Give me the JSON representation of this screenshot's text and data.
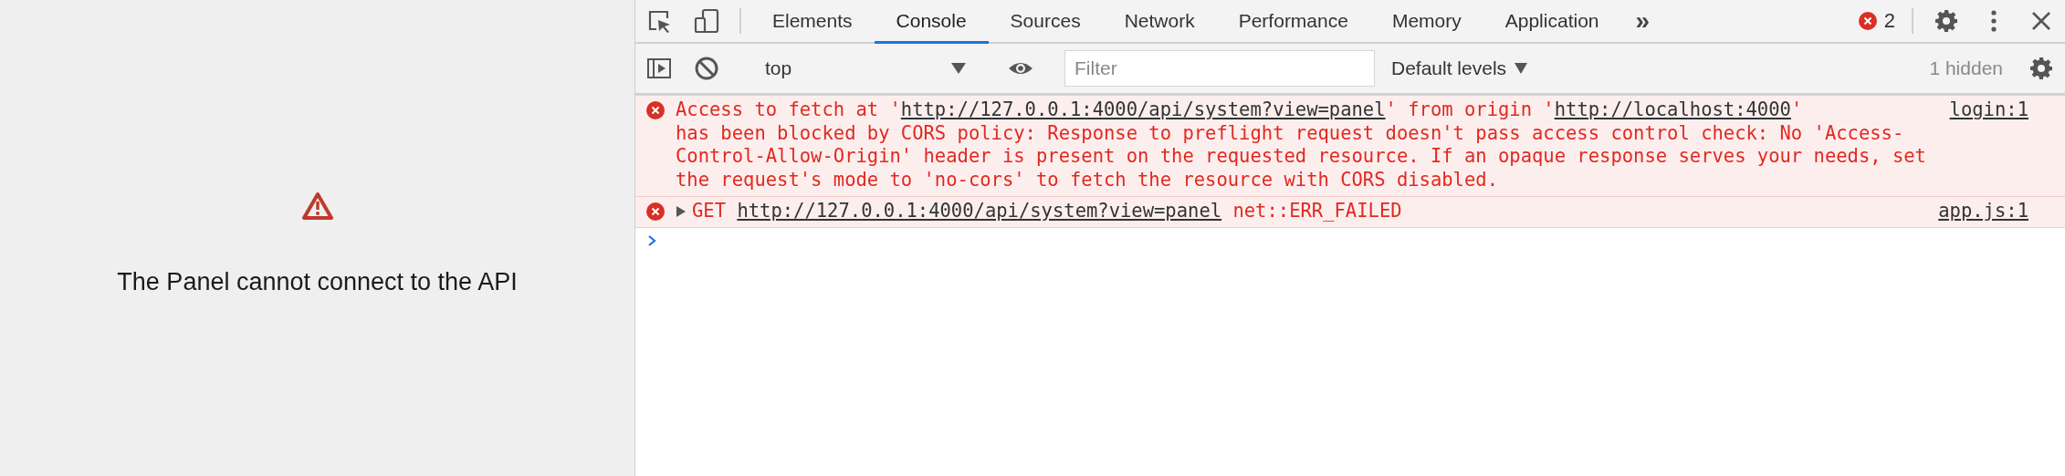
{
  "panel": {
    "message": "The Panel cannot connect to the API"
  },
  "devtools": {
    "tabs": [
      {
        "label": "Elements",
        "selected": false
      },
      {
        "label": "Console",
        "selected": true
      },
      {
        "label": "Sources",
        "selected": false
      },
      {
        "label": "Network",
        "selected": false
      },
      {
        "label": "Performance",
        "selected": false
      },
      {
        "label": "Memory",
        "selected": false
      },
      {
        "label": "Application",
        "selected": false
      }
    ],
    "more_tabs": "»",
    "error_count": "2",
    "toolbar": {
      "context": "top",
      "filter": {
        "placeholder": "Filter"
      },
      "levels": "Default levels",
      "hidden": "1 hidden"
    },
    "messages": [
      {
        "kind": "error",
        "expandable": false,
        "source": "login:1",
        "lines": [
          [
            {
              "kind": "text",
              "text": "Access to fetch at '"
            },
            {
              "kind": "link",
              "text": "http://127.0.0.1:4000/api/system?view=panel"
            },
            {
              "kind": "text",
              "text": "' from origin '"
            },
            {
              "kind": "link",
              "text": "http://localhost:4000"
            },
            {
              "kind": "text",
              "text": "'"
            }
          ],
          [
            {
              "kind": "text",
              "text": "has been blocked by CORS policy: Response to preflight request doesn't pass access control check: No 'Access-"
            }
          ],
          [
            {
              "kind": "text",
              "text": "Control-Allow-Origin' header is present on the requested resource. If an opaque response serves your needs, set"
            }
          ],
          [
            {
              "kind": "text",
              "text": "the request's mode to 'no-cors' to fetch the resource with CORS disabled."
            }
          ]
        ]
      },
      {
        "kind": "error",
        "expandable": true,
        "source": "app.js:1",
        "lines": [
          [
            {
              "kind": "text",
              "text": "GET "
            },
            {
              "kind": "link",
              "text": "http://127.0.0.1:4000/api/system?view=panel"
            },
            {
              "kind": "text",
              "text": " net::ERR_FAILED"
            }
          ]
        ]
      }
    ]
  }
}
